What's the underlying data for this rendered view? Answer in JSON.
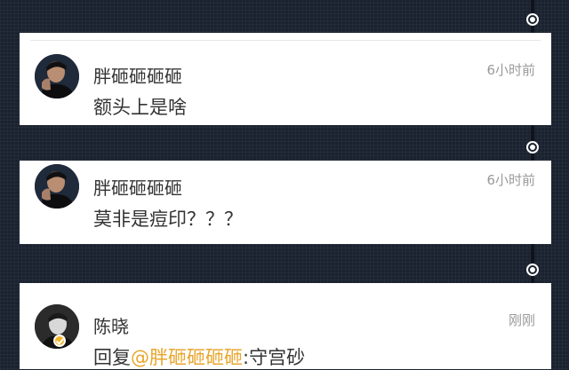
{
  "comments": [
    {
      "author": "胖砸砸砸砸",
      "time": "6小时前",
      "text": "额头上是啥",
      "avatar_icon": "user-photo-icon"
    },
    {
      "author": "胖砸砸砸砸",
      "time": "6小时前",
      "text": "莫非是痘印？？？",
      "avatar_icon": "user-photo-icon"
    },
    {
      "author": "陈晓",
      "time": "刚刚",
      "reply_prefix": "回复",
      "mention": "@胖砸砸砸砸",
      "reply_text": ":守宫砂",
      "avatar_icon": "user-photo-icon",
      "verified_badge_icon": "verified-badge-icon"
    }
  ],
  "colors": {
    "background": "#1a2230",
    "card": "#ffffff",
    "mention": "#e8a62c",
    "verified_badge": "#f3b526"
  }
}
